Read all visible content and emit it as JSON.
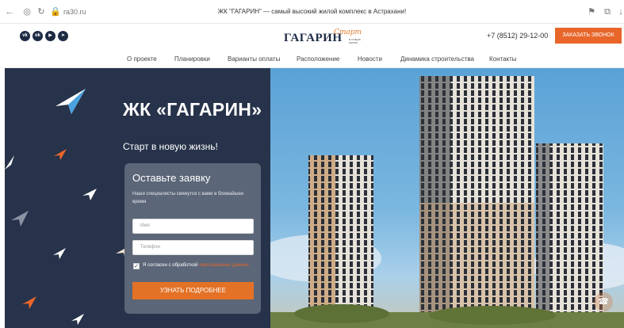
{
  "browser": {
    "url": "ra30.ru",
    "tab_title": "ЖК \"ГАГАРИН\" — самый высокий жилой комплекс в Астрахани!"
  },
  "header": {
    "social": [
      "vk",
      "ok",
      "yt",
      "tg"
    ],
    "logo_main": "ГАГАРИН",
    "logo_script": "Старт",
    "logo_sub": "в новую жизнь",
    "phone": "+7 (8512) 29-12-00",
    "call_button": "ЗАКАЗАТЬ ЗВОНОК"
  },
  "nav": {
    "items": [
      "О проекте",
      "Планировки",
      "Варианты оплаты",
      "Расположение",
      "Новости",
      "Динамика строительства",
      "Контакты"
    ]
  },
  "hero": {
    "title": "ЖК «ГАГАРИН»",
    "subtitle": "Старт в новую жизнь!"
  },
  "form": {
    "title": "Оставьте заявку",
    "description": "Наши специалисты свяжутся с вами в ближайшее время",
    "name_placeholder": "Имя",
    "phone_placeholder": "Телефон",
    "consent_text": "Я согласен с обработкой",
    "consent_link": "персональных данных",
    "submit": "УЗНАТЬ ПОДРОБНЕЕ"
  },
  "colors": {
    "accent": "#e8662a",
    "navy": "#27334a"
  }
}
